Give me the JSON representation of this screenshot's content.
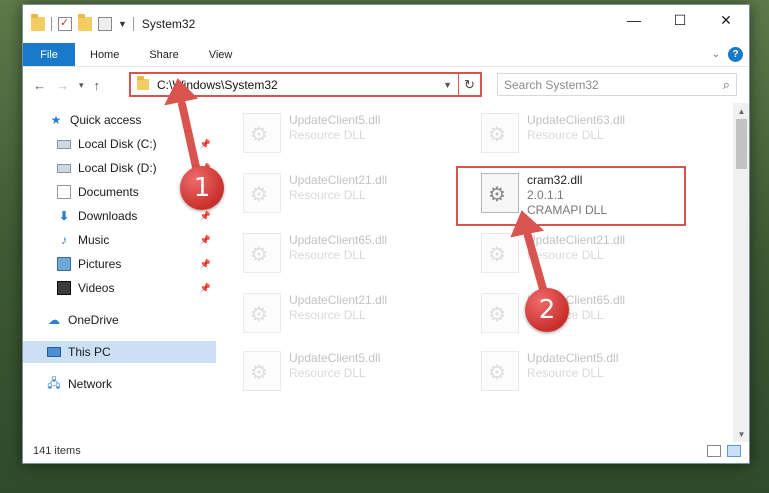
{
  "window": {
    "title": "System32",
    "controls": {
      "minimize": "—",
      "maximize": "☐",
      "close": "✕"
    }
  },
  "ribbon": {
    "tabs": [
      "File",
      "Home",
      "Share",
      "View"
    ],
    "help": "?"
  },
  "address": {
    "path": "C:\\Windows\\System32",
    "search_placeholder": "Search System32"
  },
  "navpane": {
    "quick_access": "Quick access",
    "items": [
      {
        "label": "Local Disk (C:)",
        "icon": "disk-icon",
        "pinned": true
      },
      {
        "label": "Local Disk (D:)",
        "icon": "disk-icon",
        "pinned": true
      },
      {
        "label": "Documents",
        "icon": "documents-icon",
        "pinned": true
      },
      {
        "label": "Downloads",
        "icon": "downloads-icon",
        "pinned": true
      },
      {
        "label": "Music",
        "icon": "music-icon",
        "pinned": true
      },
      {
        "label": "Pictures",
        "icon": "pictures-icon",
        "pinned": true
      },
      {
        "label": "Videos",
        "icon": "videos-icon",
        "pinned": true
      }
    ],
    "onedrive": "OneDrive",
    "thispc": "This PC",
    "network": "Network"
  },
  "files": [
    {
      "name": "UpdateClient5.dll",
      "sub": "Resource DLL"
    },
    {
      "name": "UpdateClient63.dll",
      "sub": "Resource DLL"
    },
    {
      "name": "UpdateClient21.dll",
      "sub": "Resource DLL"
    },
    {
      "name": "cram32.dll",
      "version": "2.0.1.1",
      "sub": "CRAMAPI DLL"
    },
    {
      "name": "UpdateClient65.dll",
      "sub": "Resource DLL"
    },
    {
      "name": "UpdateClient21.dll",
      "sub": "Resource DLL"
    },
    {
      "name": "UpdateClient21.dll",
      "sub": "Resource DLL"
    },
    {
      "name": "UpdateClient65.dll",
      "sub": "Resource DLL"
    },
    {
      "name": "UpdateClient5.dll",
      "sub": "Resource DLL"
    },
    {
      "name": "UpdateClient5.dll",
      "sub": "Resource DLL"
    }
  ],
  "status": {
    "items": "141 items"
  },
  "callouts": [
    "1",
    "2"
  ],
  "colors": {
    "accent": "#1979ca",
    "callout": "#d9534f",
    "selected": "#cce0f5"
  }
}
